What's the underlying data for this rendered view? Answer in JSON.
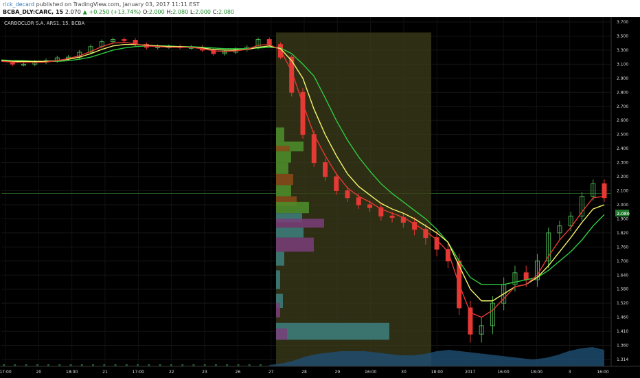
{
  "header": {
    "username": "rick_decard",
    "published_text": "published on TradingView.com, January 03, 2017 11:11 EST",
    "symbol": "BCBA_DLY:CARC, 15",
    "last": "2.070",
    "change": "+0.250 (+13.74%)",
    "o_label": "O:",
    "o_value": "2.000",
    "h_label": "H:",
    "h_value": "2.080",
    "l_label": "L:",
    "l_value": "2.000",
    "c_label": "C:",
    "c_value": "2.080"
  },
  "chart_title": "CARBOCLOR S.A. ARS1, 15, BCBA",
  "price_tag": "2.080",
  "colors": {
    "background": "#000000",
    "up": "#4caf50",
    "down": "#e53935",
    "ema_fast": "#e53935",
    "ema_mid": "#f5f56b",
    "ema_slow": "#2ecc40",
    "highlight": "#3d3d1c",
    "volume": "#1e4f73"
  },
  "chart_data": {
    "type": "candlestick",
    "title": "CARBOCLOR S.A. ARS1, 15, BCBA",
    "y_ticks": [
      3.7,
      3.5,
      3.3,
      3.1,
      2.9,
      2.8,
      2.7,
      2.6,
      2.5,
      2.4,
      2.3,
      2.2,
      2.1,
      2.0,
      1.9,
      1.82,
      1.76,
      1.7,
      1.64,
      1.58,
      1.52,
      1.46,
      1.41,
      1.36,
      1.314
    ],
    "y_tick_labels": [
      "3.700",
      "3.500",
      "3.300",
      "3.100",
      "2.900",
      "2.800",
      "2.700",
      "2.600",
      "2.500",
      "2.400",
      "2.300",
      "2.200",
      "2.100",
      "2.000",
      "1.900",
      "1.820",
      "1.760",
      "1.700",
      "1.640",
      "1.580",
      "1.520",
      "1.460",
      "1.410",
      "1.360",
      "1.314"
    ],
    "x_ticks": [
      "17:00",
      "20",
      "18:00",
      "21",
      "17:00",
      "22",
      "23",
      "26",
      "27",
      "28",
      "29",
      "16:00",
      "30",
      "18:00",
      "2017",
      "16:00",
      "18:00",
      "3",
      "16:00"
    ],
    "close_series": [
      3.12,
      3.1,
      3.1,
      3.13,
      3.15,
      3.19,
      3.2,
      3.27,
      3.35,
      3.42,
      3.45,
      3.44,
      3.38,
      3.34,
      3.35,
      3.35,
      3.34,
      3.34,
      3.3,
      3.25,
      3.27,
      3.31,
      3.34,
      3.45,
      3.38,
      3.2,
      2.8,
      2.5,
      2.3,
      2.2,
      2.1,
      2.05,
      2.0,
      1.98,
      1.92,
      1.91,
      1.88,
      1.84,
      1.8,
      1.75,
      1.7,
      1.5,
      1.4,
      1.43,
      1.52,
      1.6,
      1.65,
      1.62,
      1.7,
      1.82,
      1.86,
      1.92,
      2.06,
      2.15,
      2.05
    ],
    "ema_fast": [
      3.14,
      3.13,
      3.12,
      3.12,
      3.13,
      3.15,
      3.18,
      3.22,
      3.28,
      3.35,
      3.4,
      3.41,
      3.39,
      3.36,
      3.35,
      3.34,
      3.34,
      3.34,
      3.32,
      3.29,
      3.28,
      3.29,
      3.31,
      3.37,
      3.38,
      3.3,
      3.0,
      2.72,
      2.5,
      2.35,
      2.22,
      2.12,
      2.06,
      2.02,
      1.97,
      1.94,
      1.91,
      1.87,
      1.83,
      1.79,
      1.74,
      1.6,
      1.48,
      1.46,
      1.49,
      1.54,
      1.59,
      1.6,
      1.64,
      1.72,
      1.79,
      1.85,
      1.95,
      2.05,
      2.06
    ],
    "ema_mid": [
      3.15,
      3.14,
      3.14,
      3.14,
      3.14,
      3.15,
      3.17,
      3.2,
      3.25,
      3.31,
      3.36,
      3.38,
      3.38,
      3.37,
      3.36,
      3.35,
      3.35,
      3.34,
      3.33,
      3.31,
      3.3,
      3.3,
      3.31,
      3.34,
      3.36,
      3.32,
      3.15,
      2.9,
      2.68,
      2.5,
      2.35,
      2.22,
      2.13,
      2.07,
      2.01,
      1.97,
      1.94,
      1.9,
      1.86,
      1.82,
      1.78,
      1.68,
      1.58,
      1.53,
      1.53,
      1.56,
      1.59,
      1.6,
      1.63,
      1.68,
      1.74,
      1.8,
      1.88,
      1.97,
      2.0
    ],
    "ema_slow": [
      3.16,
      3.15,
      3.15,
      3.14,
      3.14,
      3.14,
      3.15,
      3.17,
      3.2,
      3.25,
      3.3,
      3.33,
      3.35,
      3.36,
      3.36,
      3.36,
      3.35,
      3.35,
      3.34,
      3.33,
      3.32,
      3.32,
      3.32,
      3.33,
      3.34,
      3.33,
      3.25,
      3.1,
      2.93,
      2.76,
      2.6,
      2.46,
      2.34,
      2.24,
      2.15,
      2.08,
      2.02,
      1.96,
      1.9,
      1.84,
      1.78,
      1.7,
      1.63,
      1.6,
      1.6,
      1.6,
      1.61,
      1.62,
      1.63,
      1.66,
      1.7,
      1.74,
      1.79,
      1.86,
      1.93
    ],
    "ylim": [
      1.3,
      3.72
    ],
    "grid": true,
    "legend": "none"
  }
}
